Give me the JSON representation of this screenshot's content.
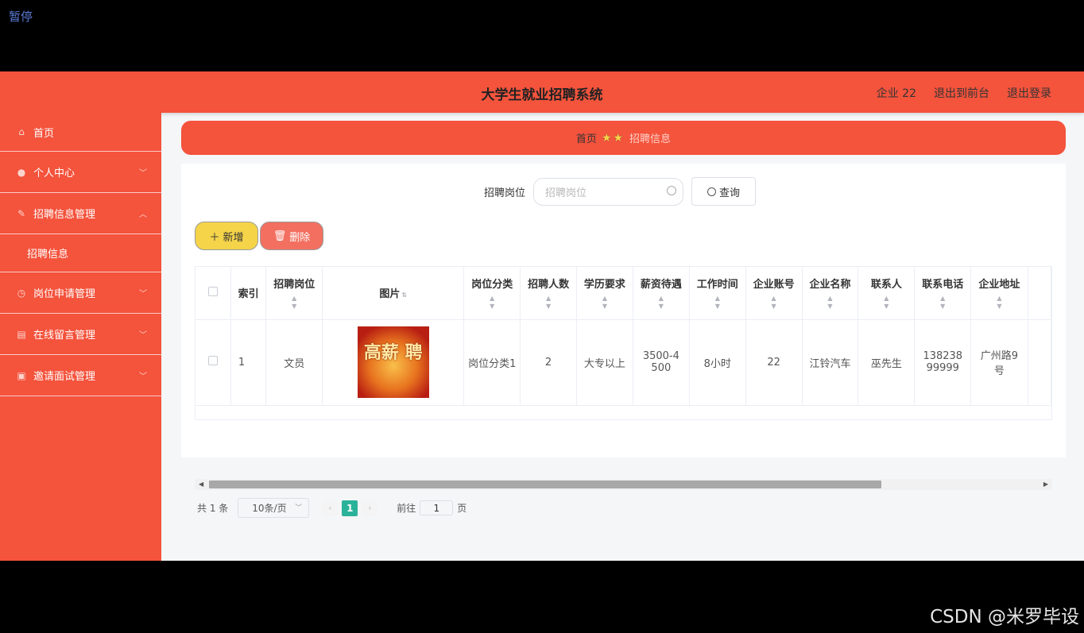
{
  "overlay": {
    "pause_label": "暂停"
  },
  "header": {
    "title": "大学生就业招聘系统",
    "user": "企业 22",
    "to_front": "退出到前台",
    "logout": "退出登录"
  },
  "sidebar": {
    "items": [
      {
        "label": "首页",
        "icon": "home-icon"
      },
      {
        "label": "个人中心",
        "icon": "user-icon"
      },
      {
        "label": "招聘信息管理",
        "icon": "edit-icon"
      },
      {
        "label": "招聘信息",
        "icon": ""
      },
      {
        "label": "岗位申请管理",
        "icon": "clock-icon"
      },
      {
        "label": "在线留言管理",
        "icon": "note-icon"
      },
      {
        "label": "邀请面试管理",
        "icon": "camera-icon"
      }
    ]
  },
  "breadcrumb": {
    "home": "首页",
    "current": "招聘信息"
  },
  "search": {
    "label": "招聘岗位",
    "placeholder": "招聘岗位",
    "button": "查询"
  },
  "actions": {
    "add": "新增",
    "delete": "删除"
  },
  "table": {
    "columns": [
      "索引",
      "招聘岗位",
      "图片",
      "岗位分类",
      "招聘人数",
      "学历要求",
      "薪资待遇",
      "工作时间",
      "企业账号",
      "企业名称",
      "联系人",
      "联系电话",
      "企业地址"
    ],
    "rows": [
      {
        "index": "1",
        "position": "文员",
        "image_text": "高薪 聘",
        "category": "岗位分类1",
        "count": "2",
        "education": "大专以上",
        "salary": "3500-4500",
        "hours": "8小时",
        "account": "22",
        "company": "江铃汽车",
        "contact": "巫先生",
        "phone": "13823899999",
        "address": "广州路9号"
      }
    ]
  },
  "pagination": {
    "total": "共 1 条",
    "page_size": "10条/页",
    "current_page": "1",
    "goto_prefix": "前往",
    "goto_value": "1",
    "goto_suffix": "页"
  },
  "watermark": "CSDN @米罗毕设",
  "colors": {
    "primary": "#f4533c",
    "add_button": "#f5d44a",
    "delete_button": "#f36f5f",
    "page_active": "#2bb29a"
  }
}
